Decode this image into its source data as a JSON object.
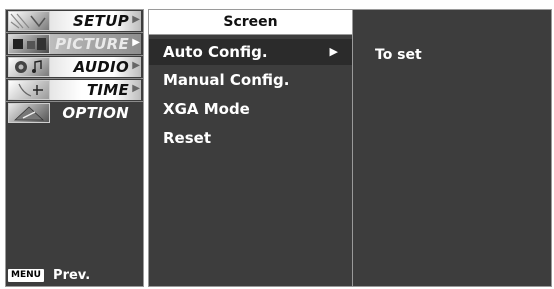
{
  "left_menu": {
    "items": [
      {
        "label": "SETUP",
        "icon": "setup-thumbnail-icon"
      },
      {
        "label": "PICTURE",
        "icon": "picture-thumbnail-icon"
      },
      {
        "label": "AUDIO",
        "icon": "audio-thumbnail-icon"
      },
      {
        "label": "TIME",
        "icon": "time-thumbnail-icon"
      },
      {
        "label": "OPTION",
        "icon": "option-thumbnail-icon"
      }
    ],
    "selected_index": 1
  },
  "footer": {
    "menu_key": "MENU",
    "prev_label": "Prev."
  },
  "submenu": {
    "title": "Screen",
    "options": [
      {
        "label": "Auto Config.",
        "active": true
      },
      {
        "label": "Manual Config.",
        "active": false
      },
      {
        "label": "XGA Mode",
        "active": false
      },
      {
        "label": "Reset",
        "active": false
      }
    ]
  },
  "detail": {
    "text": "To set"
  },
  "colors": {
    "panel_bg": "#3d3d3d",
    "border": "#9a9a9a",
    "active_row": "#2b2b2b",
    "text": "#ffffff"
  }
}
